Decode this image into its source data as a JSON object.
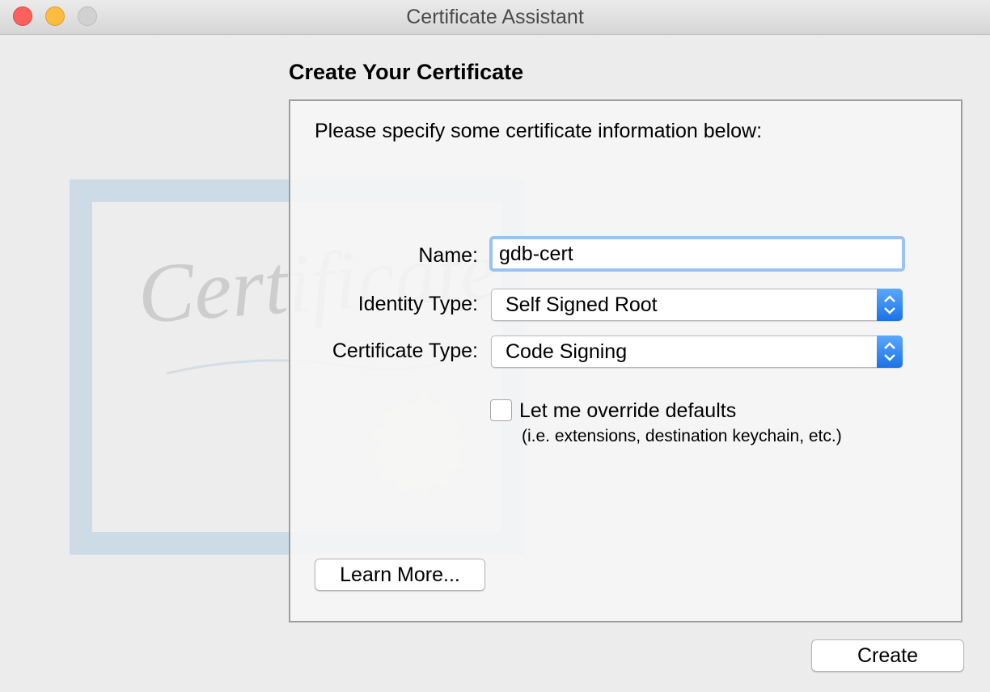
{
  "window": {
    "title": "Certificate Assistant",
    "controls": [
      "close",
      "minimize",
      "zoom"
    ]
  },
  "header": {
    "title": "Create Your Certificate"
  },
  "background_graphic": {
    "text": "Certificate"
  },
  "form": {
    "intro": "Please specify some certificate information below:",
    "name_label": "Name:",
    "name_value": "gdb-cert",
    "identity_type_label": "Identity Type:",
    "identity_type_value": "Self Signed Root",
    "certificate_type_label": "Certificate Type:",
    "certificate_type_value": "Code Signing",
    "override_label": "Let me override defaults",
    "override_note": "(i.e. extensions, destination keychain, etc.)",
    "override_checked": false
  },
  "buttons": {
    "learn_more": "Learn More...",
    "create": "Create"
  },
  "colors": {
    "accent_blue": "#1f7bec",
    "focus_ring": "#9ac3f2",
    "close": "#fc615d",
    "minimize": "#fdbc40",
    "zoom_inactive": "#d1d1d1"
  }
}
